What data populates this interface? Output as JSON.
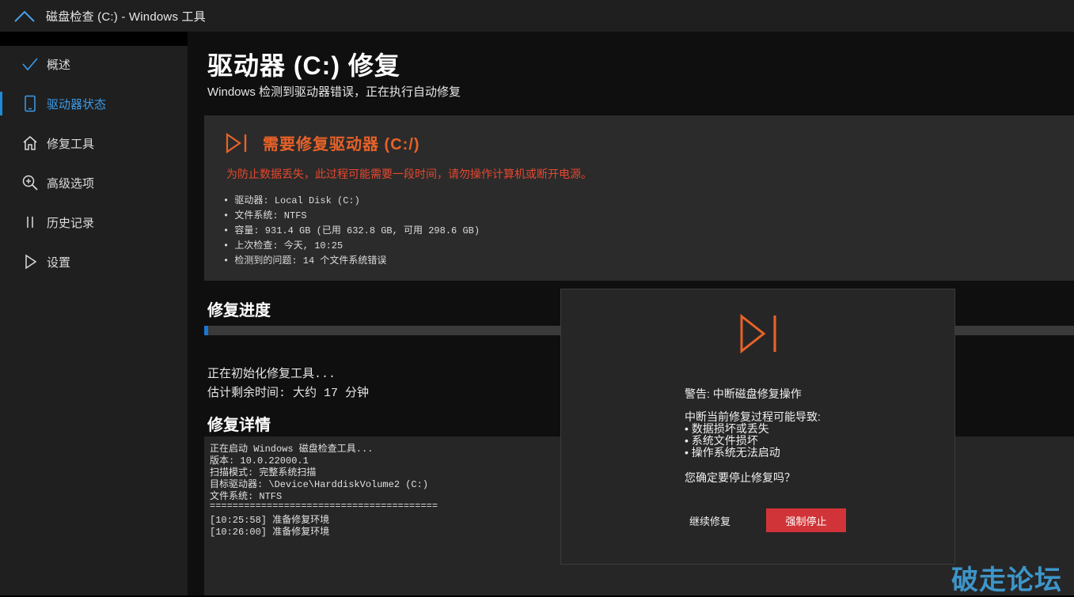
{
  "window": {
    "title": "磁盘检查 (C:) - Windows 工具"
  },
  "sidebar": {
    "items": [
      {
        "label": "概述",
        "icon": "check-icon",
        "active": false
      },
      {
        "label": "驱动器状态",
        "icon": "phone-icon",
        "active": true
      },
      {
        "label": "修复工具",
        "icon": "home-icon",
        "active": false
      },
      {
        "label": "高级选项",
        "icon": "zoom-in-icon",
        "active": false
      },
      {
        "label": "历史记录",
        "icon": "pause-icon",
        "active": false
      },
      {
        "label": "设置",
        "icon": "play-icon",
        "active": false
      }
    ]
  },
  "header": {
    "title": "驱动器 (C:) 修复",
    "subtitle": "Windows 检测到驱动器错误，正在执行自动修复"
  },
  "card": {
    "title": "需要修复驱动器 (C:/)",
    "warning": "为防止数据丢失，此过程可能需要一段时间，请勿操作计算机或断开电源。",
    "details": [
      "• 驱动器: Local Disk (C:)",
      "• 文件系统: NTFS",
      "• 容量: 931.4 GB (已用 632.8 GB, 可用 298.6 GB)",
      "• 上次检查: 今天, 10:25",
      "• 检测到的问题: 14 个文件系统错误"
    ],
    "accent": "#e86228"
  },
  "progress": {
    "title": "修复进度",
    "value_percent": 0.5,
    "status": "正在初始化修复工具...",
    "eta": "估计剩余时间: 大约 17 分钟"
  },
  "details": {
    "title": "修复详情",
    "log": [
      "正在启动 Windows 磁盘检查工具...",
      "版本: 10.0.22000.1",
      "扫描模式: 完整系统扫描",
      "目标驱动器: \\Device\\HarddiskVolume2 (C:)",
      "文件系统: NTFS",
      "========================================",
      "[10:25:58] 准备修复环境",
      "[10:26:00] 准备修复环境"
    ]
  },
  "dialog": {
    "icon": "skip-next-icon",
    "heading": "警告: 中断磁盘修复操作",
    "intro": "中断当前修复过程可能导致:",
    "bullets": [
      "• 数据损坏或丢失",
      "• 系统文件损坏",
      "• 操作系统无法启动"
    ],
    "question": "您确定要停止修复吗？",
    "continue_label": "继续修复",
    "stop_label": "强制停止",
    "stop_color": "#d13438"
  },
  "watermark": "破走论坛"
}
